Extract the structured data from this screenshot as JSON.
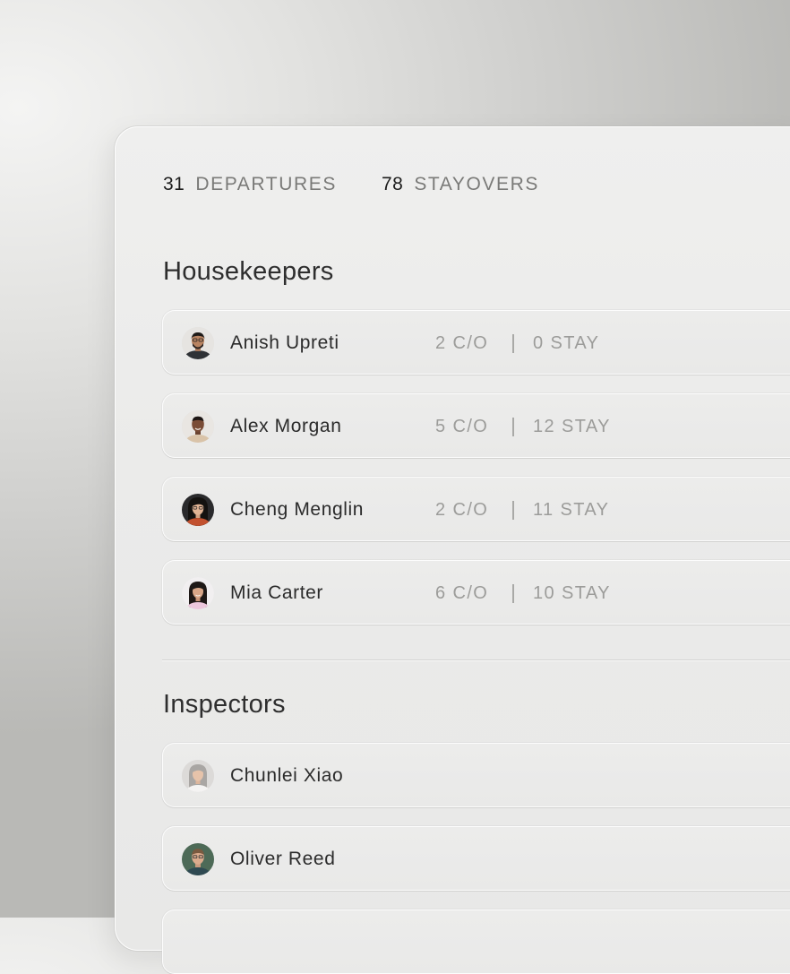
{
  "summary": {
    "departures_count": "31",
    "departures_label": "DEPARTURES",
    "stayovers_count": "78",
    "stayovers_label": "STAYOVERS"
  },
  "housekeepers": {
    "title": "Housekeepers",
    "rows": [
      {
        "name": "Anish Upreti",
        "checkouts": "2 C/O",
        "stays": "0 STAY"
      },
      {
        "name": "Alex Morgan",
        "checkouts": "5 C/O",
        "stays": "12 STAY"
      },
      {
        "name": "Cheng Menglin",
        "checkouts": "2 C/O",
        "stays": "11 STAY"
      },
      {
        "name": "Mia Carter",
        "checkouts": "6 C/O",
        "stays": "10 STAY"
      }
    ]
  },
  "inspectors": {
    "title": "Inspectors",
    "rows": [
      {
        "name": "Chunlei Xiao"
      },
      {
        "name": "Oliver Reed"
      }
    ]
  }
}
